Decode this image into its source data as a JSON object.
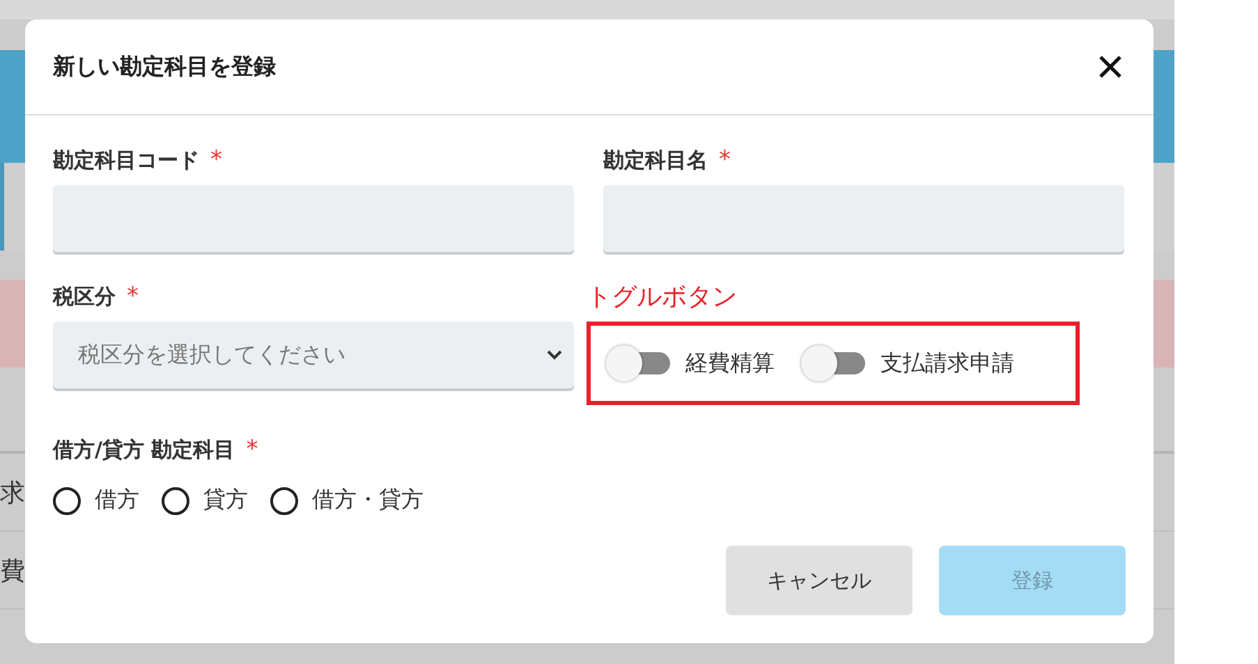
{
  "background": {
    "rows": [
      {
        "text": "求"
      },
      {
        "text": "費"
      }
    ]
  },
  "dialog": {
    "title": "新しい勘定科目を登録",
    "required_mark": "*",
    "fields": [
      {
        "kind": "text",
        "label": "勘定科目コード",
        "required": true
      },
      {
        "kind": "text",
        "label": "勘定科目名",
        "required": true
      },
      {
        "kind": "select",
        "label": "税区分",
        "required": true,
        "placeholder": "税区分を選択してください"
      }
    ],
    "annotation": {
      "text": "トグルボタン"
    },
    "toggles": [
      {
        "label": "経費精算",
        "on": false
      },
      {
        "label": "支払請求申請",
        "on": false
      }
    ],
    "radio_group": {
      "label": "借方/貸方 勘定科目",
      "required": true,
      "options": [
        {
          "label": "借方",
          "selected": false
        },
        {
          "label": "貸方",
          "selected": false
        },
        {
          "label": "借方・貸方",
          "selected": false
        }
      ]
    },
    "buttons": [
      {
        "kind": "secondary",
        "label": "キャンセル",
        "disabled": false
      },
      {
        "kind": "primary",
        "label": "登録",
        "disabled": true
      }
    ]
  }
}
